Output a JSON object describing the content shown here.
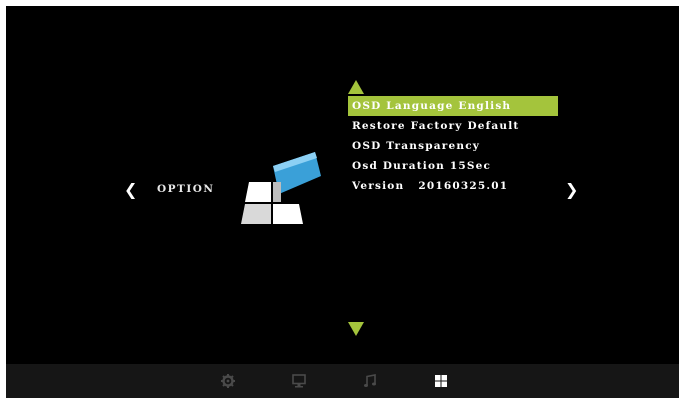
{
  "header": {
    "section_label": "OPTION"
  },
  "menu": {
    "items": [
      {
        "label": "OSD Language English",
        "selected": true
      },
      {
        "label": "Restore Factory Default",
        "selected": false
      },
      {
        "label": "OSD Transparency",
        "selected": false
      },
      {
        "label": "Osd Duration 15Sec",
        "selected": false
      }
    ],
    "version_label": "Version",
    "version_value": "20160325.01"
  },
  "bottom_bar": {
    "icons": [
      "gear-icon",
      "monitor-icon",
      "music-note-icon",
      "grid-icon"
    ],
    "active": "grid-icon"
  },
  "colors": {
    "background": "#000000",
    "highlight": "#a4c43c",
    "tile_blue": "#3aa0d8",
    "text": "#ffffff",
    "inactive_icon": "#4a4a4a"
  }
}
